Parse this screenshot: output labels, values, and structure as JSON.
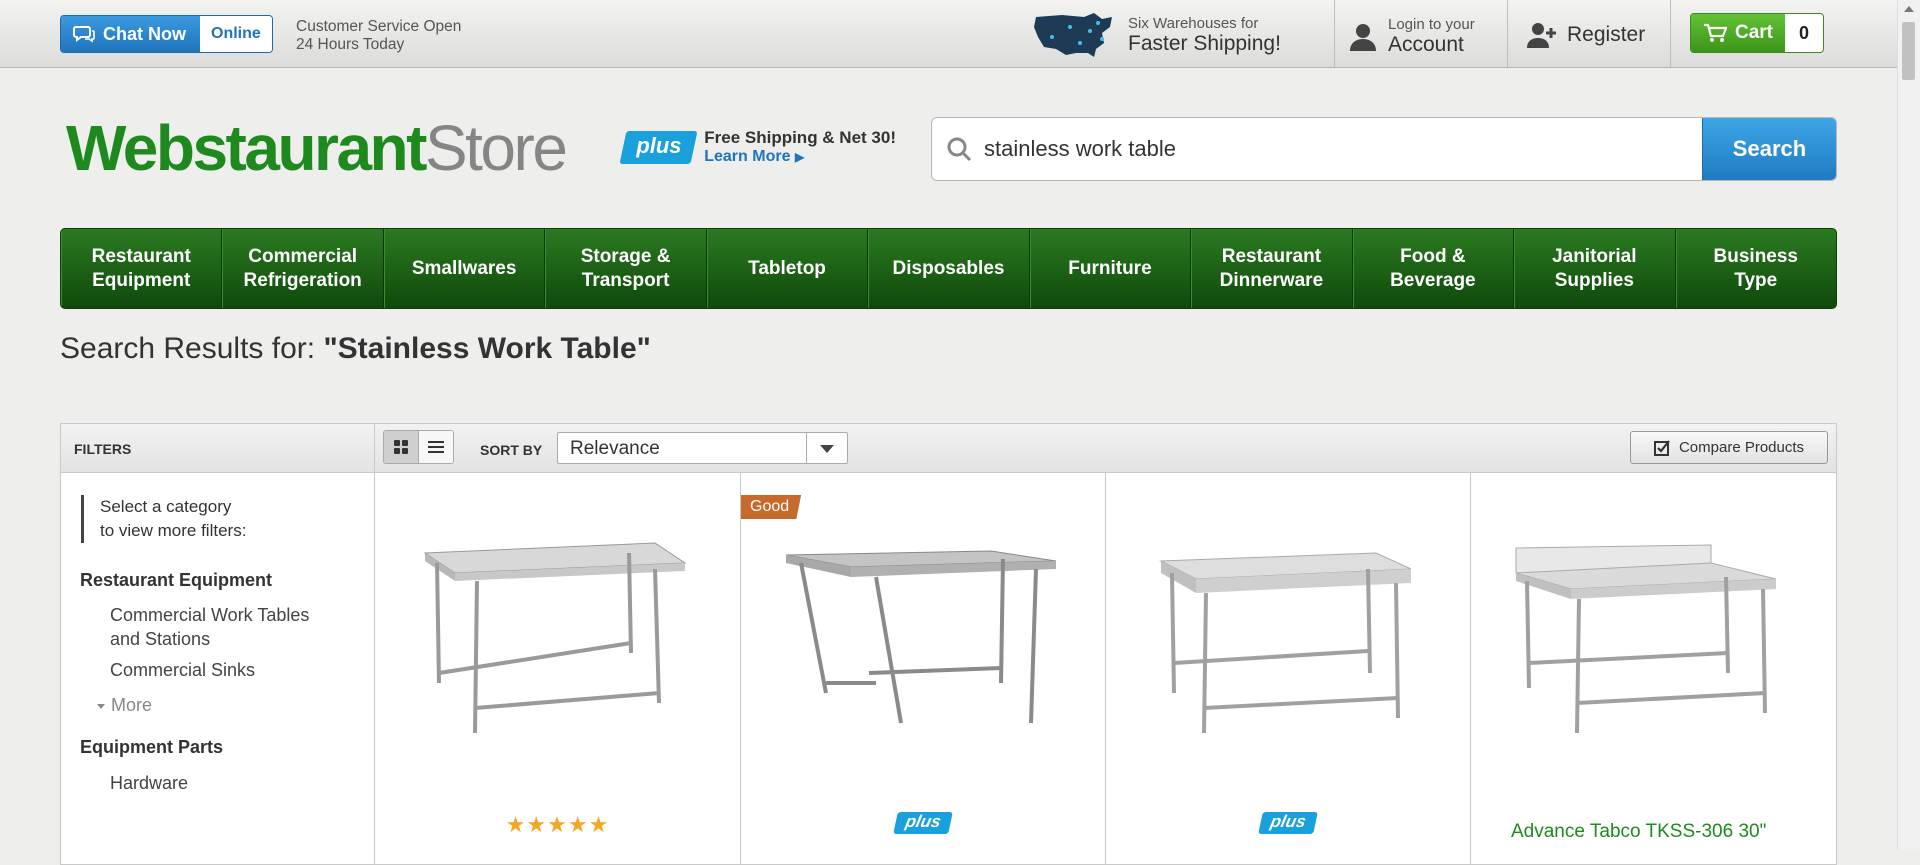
{
  "topbar": {
    "chat_label": "Chat Now",
    "chat_status": "Online",
    "customer_service_line1": "Customer Service Open",
    "customer_service_line2": "24 Hours Today",
    "warehouses_line1": "Six Warehouses for",
    "warehouses_line2": "Faster Shipping!",
    "account_line1": "Login to your",
    "account_line2": "Account",
    "register_label": "Register",
    "cart_label": "Cart",
    "cart_count": "0"
  },
  "header": {
    "logo_part1": "Webstaurant",
    "logo_part2": "Store",
    "plus_badge": "plus",
    "promo_line1": "Free Shipping & Net 30!",
    "promo_line2": "Learn More",
    "search_value": "stainless work table",
    "search_button": "Search"
  },
  "nav": {
    "items": [
      {
        "line1": "Restaurant",
        "line2": "Equipment"
      },
      {
        "line1": "Commercial",
        "line2": "Refrigeration"
      },
      {
        "line1": "Smallwares",
        "line2": ""
      },
      {
        "line1": "Storage &",
        "line2": "Transport"
      },
      {
        "line1": "Tabletop",
        "line2": ""
      },
      {
        "line1": "Disposables",
        "line2": ""
      },
      {
        "line1": "Furniture",
        "line2": ""
      },
      {
        "line1": "Restaurant",
        "line2": "Dinnerware"
      },
      {
        "line1": "Food &",
        "line2": "Beverage"
      },
      {
        "line1": "Janitorial",
        "line2": "Supplies"
      },
      {
        "line1": "Business",
        "line2": "Type"
      }
    ]
  },
  "results": {
    "title_prefix": "Search Results for: ",
    "query": "\"Stainless Work Table\""
  },
  "toolbar": {
    "filters_label": "FILTERS",
    "sort_label": "SORT BY",
    "sort_value": "Relevance",
    "compare_label": "Compare Products"
  },
  "filters": {
    "note_line1": "Select a category",
    "note_line2": "to view more filters:",
    "group1_title": "Restaurant Equipment",
    "group1_items": [
      "Commercial Work Tables and Stations",
      "Commercial Sinks"
    ],
    "more_label": "More",
    "group2_title": "Equipment Parts",
    "group2_items": [
      "Hardware"
    ]
  },
  "products": [
    {
      "badge": "",
      "stars": "★★★★★",
      "plus": ""
    },
    {
      "badge": "Good",
      "stars": "",
      "plus": "plus"
    },
    {
      "badge": "",
      "stars": "",
      "plus": "plus"
    },
    {
      "badge": "",
      "stars": "",
      "plus": "",
      "title": "Advance Tabco TKSS-306 30\""
    }
  ],
  "colors": {
    "brand_green": "#1e8a1e",
    "nav_green": "#145a10",
    "accent_blue": "#1f74bc",
    "plus_blue": "#1aa0dd",
    "badge_orange": "#c76a2c",
    "cart_green": "#3c9418"
  },
  "icons": [
    "chat-bubble-icon",
    "usa-map-icon",
    "user-icon",
    "add-user-icon",
    "cart-icon",
    "search-icon",
    "grid-view-icon",
    "list-view-icon",
    "checkbox-icon"
  ]
}
